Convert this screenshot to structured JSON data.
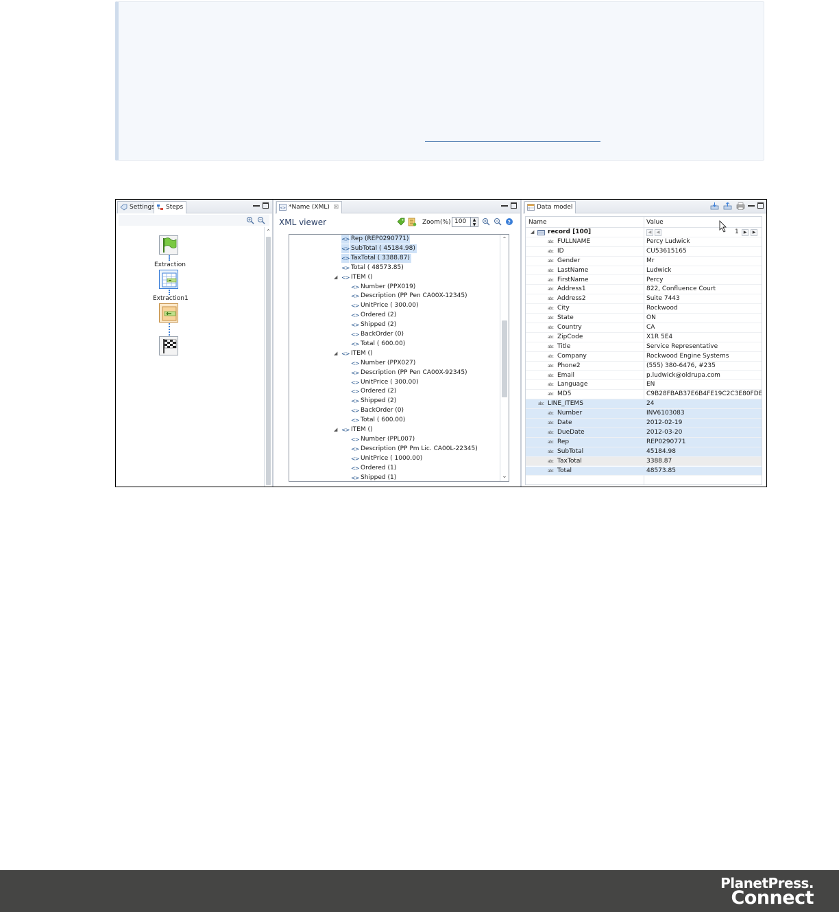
{
  "steps_pane": {
    "tabs": [
      {
        "label": "Settings",
        "icon": "settings-icon"
      },
      {
        "label": "Steps",
        "icon": "steps-icon"
      }
    ],
    "steps": [
      {
        "label": "",
        "icon": "start-flag-icon"
      },
      {
        "label": "Extraction",
        "icon": "extraction-table-icon"
      },
      {
        "label": "Extraction1",
        "icon": "extraction-field-icon"
      },
      {
        "label": "",
        "icon": "finish-flag-icon"
      }
    ]
  },
  "xml_pane": {
    "tab_label": "*Name (XML)",
    "tab_close": "☒",
    "title": "XML viewer",
    "zoom_label": "Zoom(%)",
    "zoom_value": "100",
    "tag_glyph": "<>",
    "rows": [
      {
        "indent": 1,
        "text": "Rep  (REP0290771)",
        "selected": true
      },
      {
        "indent": 1,
        "text": "SubTotal  (  45184.98)",
        "selected": true
      },
      {
        "indent": 1,
        "text": "TaxTotal  (   3388.87)",
        "selected": true
      },
      {
        "indent": 1,
        "text": "Total  (  48573.85)",
        "selected": false
      },
      {
        "indent": 1,
        "text": "ITEM  ()",
        "selected": false,
        "expander": "◢"
      },
      {
        "indent": 2,
        "text": "Number  (PPX019)",
        "selected": false
      },
      {
        "indent": 2,
        "text": "Description  (PP Pen CA00X-12345)",
        "selected": false
      },
      {
        "indent": 2,
        "text": "UnitPrice  (    300.00)",
        "selected": false
      },
      {
        "indent": 2,
        "text": "Ordered  (2)",
        "selected": false
      },
      {
        "indent": 2,
        "text": "Shipped  (2)",
        "selected": false
      },
      {
        "indent": 2,
        "text": "BackOrder  (0)",
        "selected": false
      },
      {
        "indent": 2,
        "text": "Total  (    600.00)",
        "selected": false
      },
      {
        "indent": 1,
        "text": "ITEM  ()",
        "selected": false,
        "expander": "◢"
      },
      {
        "indent": 2,
        "text": "Number  (PPX027)",
        "selected": false
      },
      {
        "indent": 2,
        "text": "Description  (PP Pen CA00X-92345)",
        "selected": false
      },
      {
        "indent": 2,
        "text": "UnitPrice  (    300.00)",
        "selected": false
      },
      {
        "indent": 2,
        "text": "Ordered  (2)",
        "selected": false
      },
      {
        "indent": 2,
        "text": "Shipped  (2)",
        "selected": false
      },
      {
        "indent": 2,
        "text": "BackOrder  (0)",
        "selected": false
      },
      {
        "indent": 2,
        "text": "Total  (    600.00)",
        "selected": false
      },
      {
        "indent": 1,
        "text": "ITEM  ()",
        "selected": false,
        "expander": "◢"
      },
      {
        "indent": 2,
        "text": "Number  (PPL007)",
        "selected": false
      },
      {
        "indent": 2,
        "text": "Description  (PP Pm Lic. CA00L-22345)",
        "selected": false
      },
      {
        "indent": 2,
        "text": "UnitPrice  (   1000.00)",
        "selected": false
      },
      {
        "indent": 2,
        "text": "Ordered  (1)",
        "selected": false
      },
      {
        "indent": 2,
        "text": "Shipped  (1)",
        "selected": false
      }
    ]
  },
  "data_model_pane": {
    "tab_label": "Data model",
    "col_name": "Name",
    "col_value": "Value",
    "record_label": "record [100]",
    "record_counter": "1",
    "field_glyph": "abc",
    "fields": [
      {
        "name": "FULLNAME",
        "value": "Percy Ludwick",
        "hl": ""
      },
      {
        "name": "ID",
        "value": "CU53615165",
        "hl": ""
      },
      {
        "name": "Gender",
        "value": "Mr",
        "hl": ""
      },
      {
        "name": "LastName",
        "value": "Ludwick",
        "hl": ""
      },
      {
        "name": "FirstName",
        "value": "Percy",
        "hl": ""
      },
      {
        "name": "Address1",
        "value": "822, Confluence Court",
        "hl": ""
      },
      {
        "name": "Address2",
        "value": "Suite 7443",
        "hl": ""
      },
      {
        "name": "City",
        "value": "Rockwood",
        "hl": ""
      },
      {
        "name": "State",
        "value": "ON",
        "hl": ""
      },
      {
        "name": "Country",
        "value": "CA",
        "hl": ""
      },
      {
        "name": "ZipCode",
        "value": "X1R 5E4",
        "hl": ""
      },
      {
        "name": "Title",
        "value": "Service Representative",
        "hl": ""
      },
      {
        "name": "Company",
        "value": "Rockwood Engine Systems",
        "hl": ""
      },
      {
        "name": "Phone2",
        "value": "(555) 380-6476, #235",
        "hl": ""
      },
      {
        "name": "Email",
        "value": "p.ludwick@oldrupa.com",
        "hl": ""
      },
      {
        "name": "Language",
        "value": "EN",
        "hl": ""
      },
      {
        "name": "MD5",
        "value": "C9B28FBAB37E6B4FE19C2C3E80FDEBDE",
        "hl": ""
      },
      {
        "name": "LINE_ITEMS",
        "value": "24",
        "hl": "hl",
        "indent": "low"
      },
      {
        "name": "Number",
        "value": "INV6103083",
        "hl": "hl"
      },
      {
        "name": "Date",
        "value": "2012-02-19",
        "hl": "hl"
      },
      {
        "name": "DueDate",
        "value": "2012-03-20",
        "hl": "hl"
      },
      {
        "name": "Rep",
        "value": "REP0290771",
        "hl": "hl"
      },
      {
        "name": "SubTotal",
        "value": "45184.98",
        "hl": "hl"
      },
      {
        "name": "TaxTotal",
        "value": "3388.87",
        "hl": "hl2"
      },
      {
        "name": "Total",
        "value": "48573.85",
        "hl": "hl"
      }
    ]
  },
  "footer": {
    "brand_line1": "PlanetPress.",
    "brand_line2": "Connect",
    "background": "#454544"
  }
}
